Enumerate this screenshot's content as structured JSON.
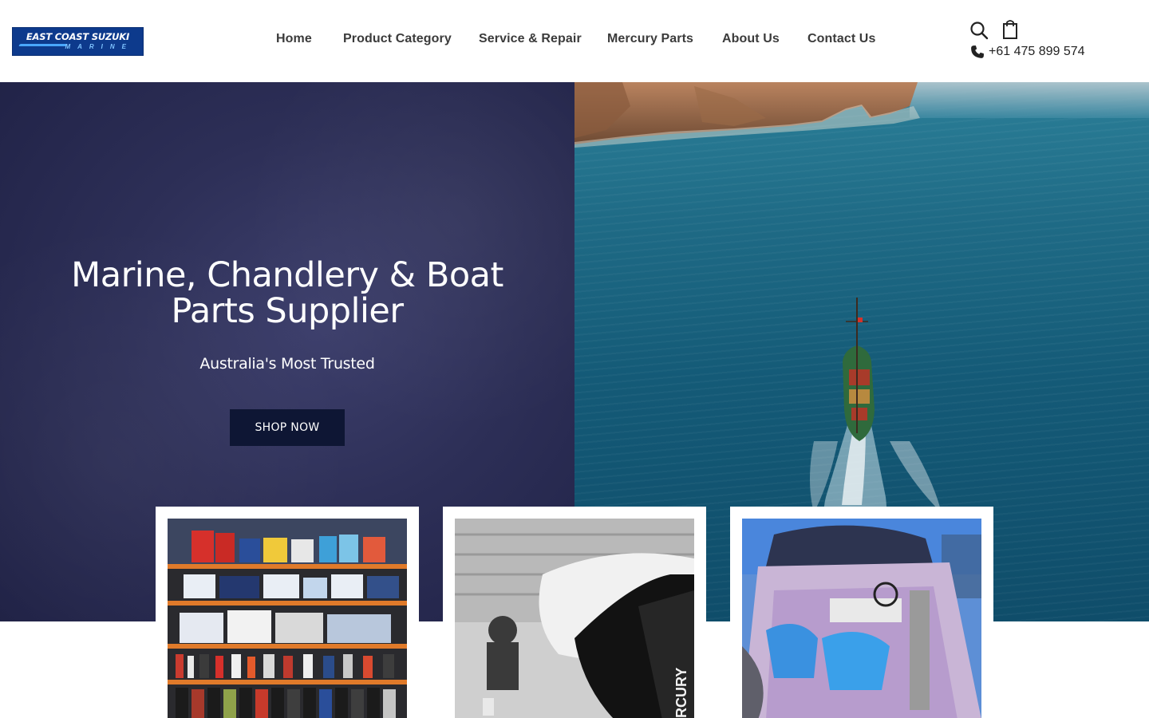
{
  "header": {
    "logo": {
      "line1": "EAST COAST SUZUKI",
      "line2": "MARINE"
    },
    "nav": [
      {
        "label": "Home"
      },
      {
        "label": "Product Category"
      },
      {
        "label": "Service & Repair"
      },
      {
        "label": "Mercury Parts"
      },
      {
        "label": "About Us"
      },
      {
        "label": "Contact Us"
      }
    ],
    "icons": [
      "search-icon",
      "shopping-bag-icon",
      "phone-icon"
    ],
    "phone": "+61 475 899 574"
  },
  "hero": {
    "title": "Marine, Chandlery & Boat Parts Supplier",
    "subtitle": "Australia's Most Trusted",
    "cta": "SHOP NOW",
    "colors": {
      "left_bg": "#2d2f57",
      "button_bg": "#0e1634",
      "sea": "#145a77"
    }
  },
  "cards": [
    {
      "name": "products-shelf-image"
    },
    {
      "name": "mercury-service-image"
    },
    {
      "name": "boat-interior-image"
    }
  ]
}
